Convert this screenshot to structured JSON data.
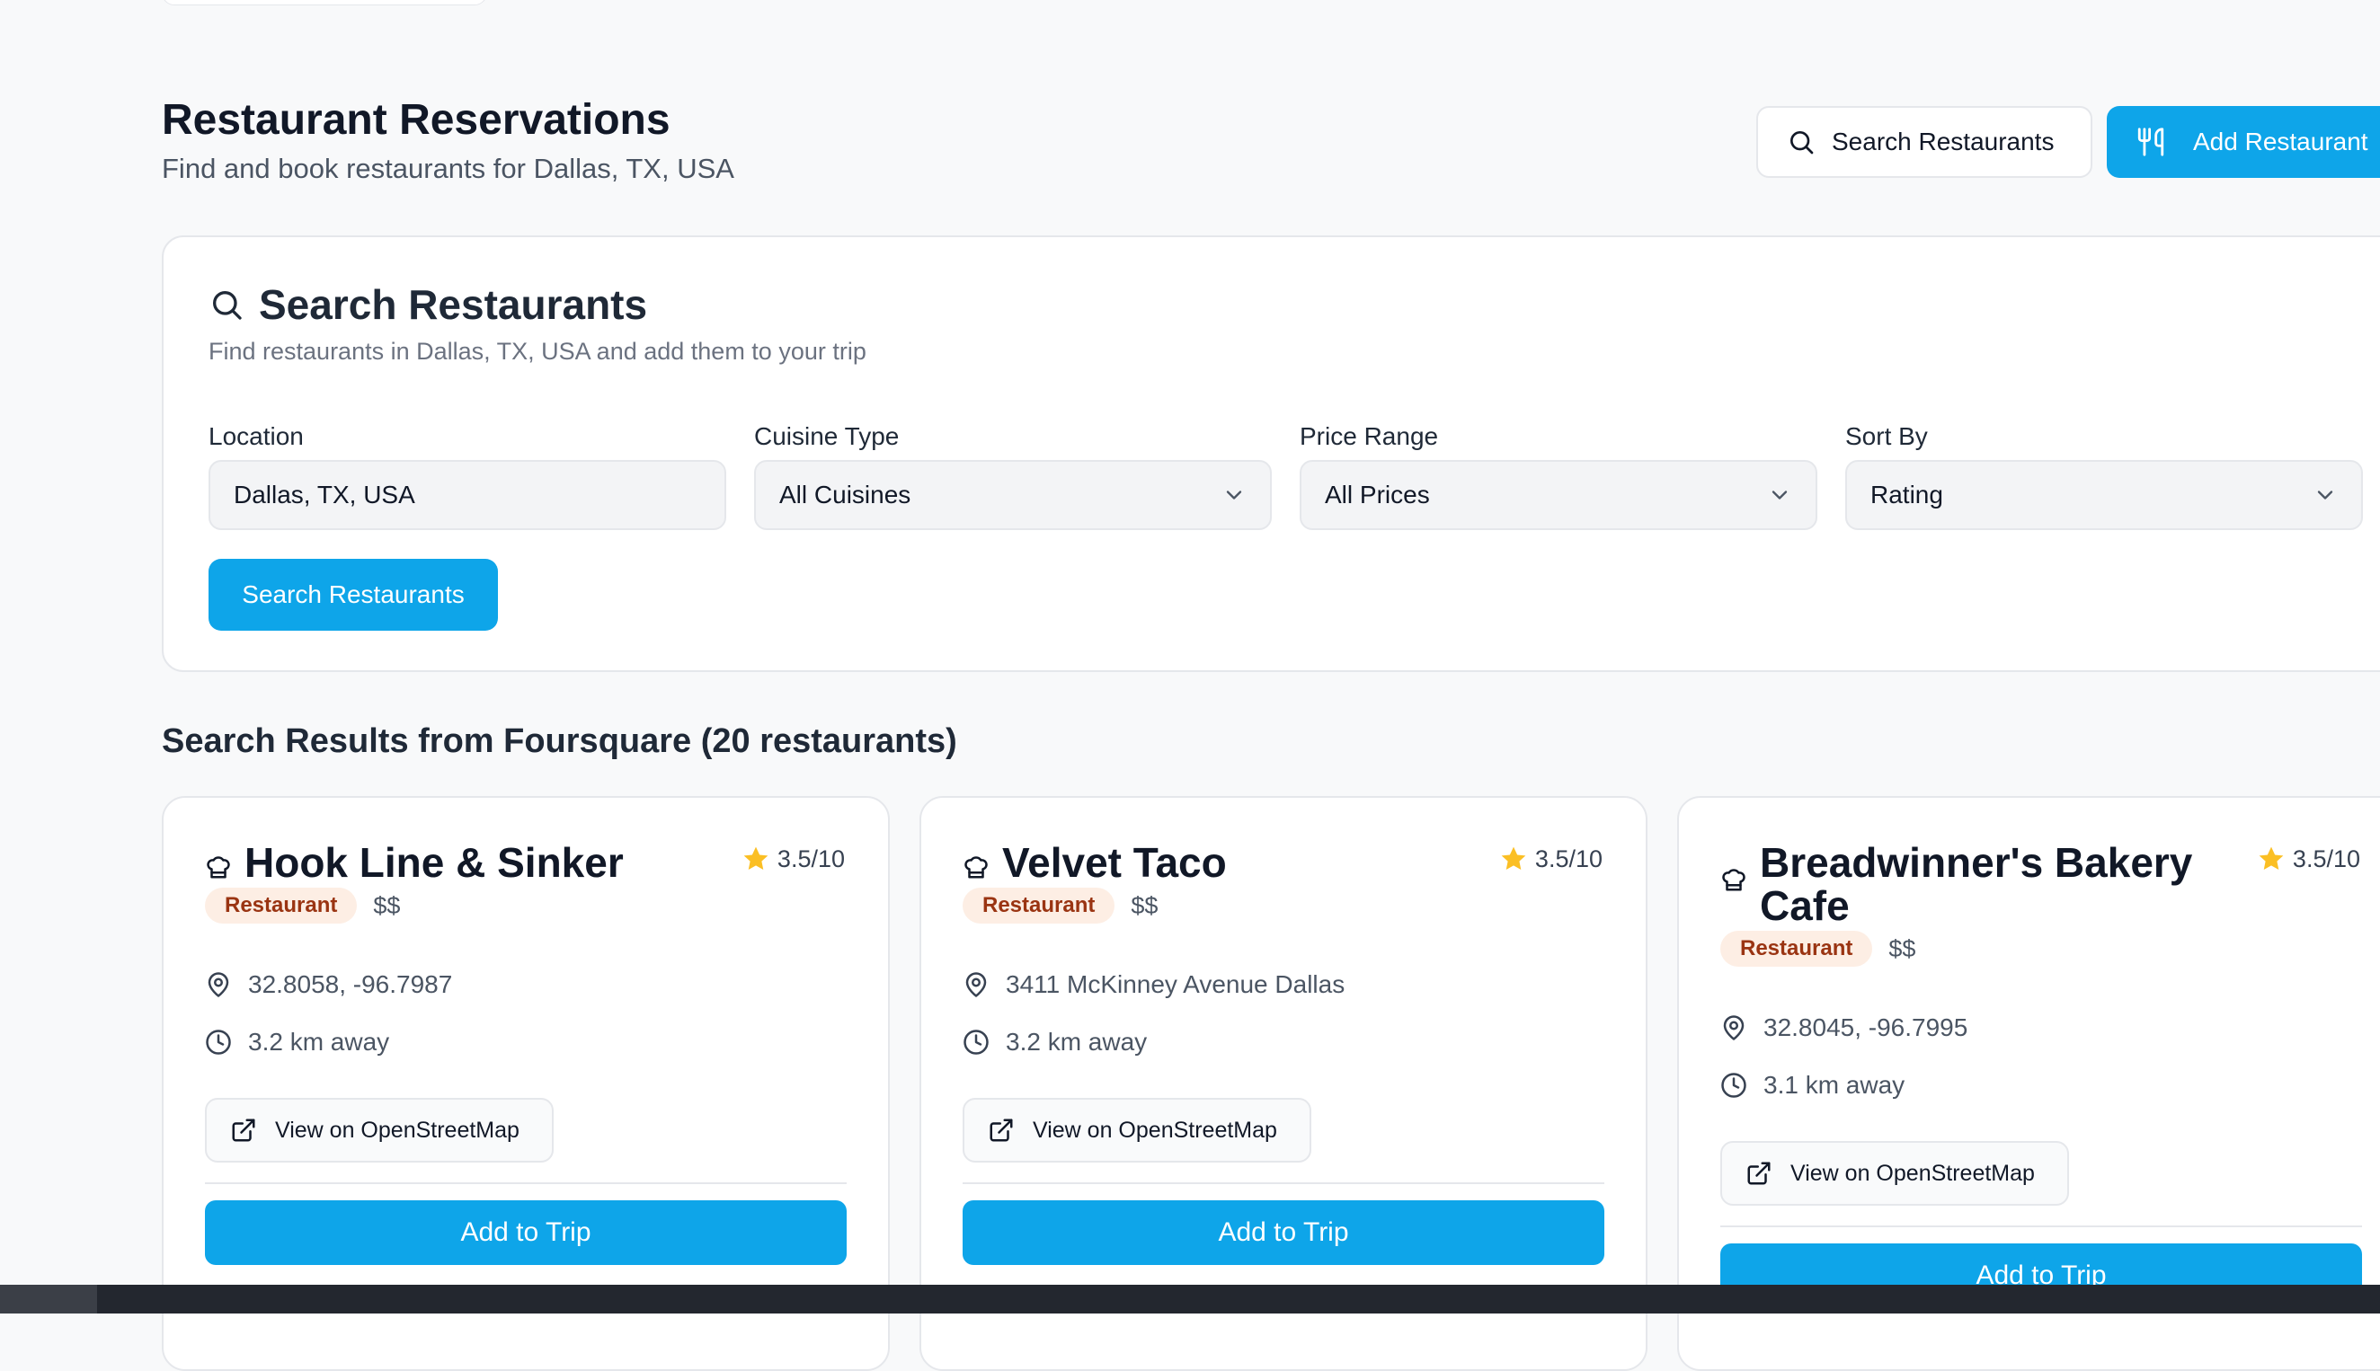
{
  "header": {
    "title": "Restaurant Reservations",
    "subtitle": "Find and book restaurants for Dallas, TX, USA",
    "search_button": "Search Restaurants",
    "add_button": "Add Restaurant"
  },
  "search": {
    "title": "Search Restaurants",
    "subtitle": "Find restaurants in Dallas, TX, USA and add them to your trip",
    "location_label": "Location",
    "location_value": "Dallas, TX, USA",
    "cuisine_label": "Cuisine Type",
    "cuisine_value": "All Cuisines",
    "price_label": "Price Range",
    "price_value": "All Prices",
    "sort_label": "Sort By",
    "sort_value": "Rating",
    "button": "Search Restaurants"
  },
  "results": {
    "title": "Search Results from Foursquare (20 restaurants)",
    "cards": [
      {
        "name": "Hook Line & Sinker",
        "rating": "3.5/10",
        "badge": "Restaurant",
        "price": "$$",
        "location": "32.8058, -96.7987",
        "distance": "3.2 km away",
        "map_button": "View on OpenStreetMap",
        "add_button": "Add to Trip"
      },
      {
        "name": "Velvet Taco",
        "rating": "3.5/10",
        "badge": "Restaurant",
        "price": "$$",
        "location": "3411 McKinney Avenue Dallas",
        "distance": "3.2 km away",
        "map_button": "View on OpenStreetMap",
        "add_button": "Add to Trip"
      },
      {
        "name": "Breadwinner's Bakery Cafe",
        "rating": "3.5/10",
        "badge": "Restaurant",
        "price": "$$",
        "location": "32.8045, -96.7995",
        "distance": "3.1 km away",
        "map_button": "View on OpenStreetMap",
        "add_button": "Add to Trip"
      }
    ]
  },
  "colors": {
    "accent": "#0ea5e9",
    "badge_bg": "#fdeee4",
    "badge_text": "#9a3412",
    "star": "#fbbf24"
  }
}
